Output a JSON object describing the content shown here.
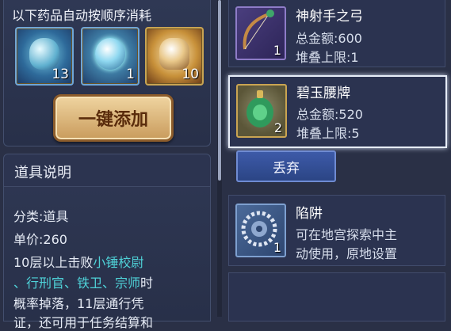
{
  "consume": {
    "title": "以下药品自动按顺序消耗",
    "slots": [
      {
        "count": "13",
        "icon": "potion-jar-icon"
      },
      {
        "count": "1",
        "icon": "crystal-orb-icon"
      },
      {
        "count": "10",
        "icon": "golden-gourd-icon"
      }
    ],
    "add_button": "一键添加"
  },
  "description": {
    "title": "道具说明",
    "lines": [
      "分类:道具",
      "单价:260"
    ],
    "text_l1_prefix": "10层以上击败",
    "text_l1_link": "小锤校尉",
    "text_l2_link": "、行刑官、铁卫、宗师",
    "text_l2_suffix": "时",
    "text_l3": "概率掉落，11层通行凭",
    "text_l4": "证，还可用于任务结算和"
  },
  "items": [
    {
      "name": "神射手之弓",
      "line1": "总金额:600",
      "line2": "堆叠上限:1",
      "stack": "1",
      "icon": "bow-icon"
    },
    {
      "name": "碧玉腰牌",
      "line1": "总金额:520",
      "line2": "堆叠上限:5",
      "stack": "2",
      "icon": "jade-token-icon"
    },
    {
      "name": "陷阱",
      "line1": "可在地宫探索中主",
      "line2": "动使用，原地设置",
      "stack": "1",
      "icon": "trap-icon"
    }
  ],
  "discard_button": "丢弃",
  "colors": {
    "gold_border": "#c9a452",
    "link_cyan": "#4fd2d8",
    "button_blue": "#3d5aa8"
  }
}
